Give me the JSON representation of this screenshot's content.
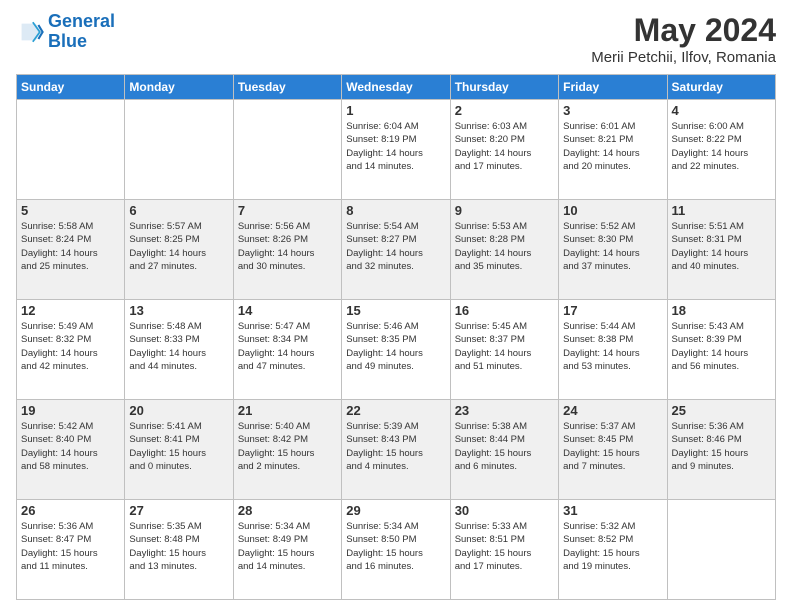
{
  "logo": {
    "line1": "General",
    "line2": "Blue"
  },
  "title": "May 2024",
  "subtitle": "Merii Petchii, Ilfov, Romania",
  "days_of_week": [
    "Sunday",
    "Monday",
    "Tuesday",
    "Wednesday",
    "Thursday",
    "Friday",
    "Saturday"
  ],
  "weeks": [
    [
      {
        "day": "",
        "info": ""
      },
      {
        "day": "",
        "info": ""
      },
      {
        "day": "",
        "info": ""
      },
      {
        "day": "1",
        "info": "Sunrise: 6:04 AM\nSunset: 8:19 PM\nDaylight: 14 hours\nand 14 minutes."
      },
      {
        "day": "2",
        "info": "Sunrise: 6:03 AM\nSunset: 8:20 PM\nDaylight: 14 hours\nand 17 minutes."
      },
      {
        "day": "3",
        "info": "Sunrise: 6:01 AM\nSunset: 8:21 PM\nDaylight: 14 hours\nand 20 minutes."
      },
      {
        "day": "4",
        "info": "Sunrise: 6:00 AM\nSunset: 8:22 PM\nDaylight: 14 hours\nand 22 minutes."
      }
    ],
    [
      {
        "day": "5",
        "info": "Sunrise: 5:58 AM\nSunset: 8:24 PM\nDaylight: 14 hours\nand 25 minutes."
      },
      {
        "day": "6",
        "info": "Sunrise: 5:57 AM\nSunset: 8:25 PM\nDaylight: 14 hours\nand 27 minutes."
      },
      {
        "day": "7",
        "info": "Sunrise: 5:56 AM\nSunset: 8:26 PM\nDaylight: 14 hours\nand 30 minutes."
      },
      {
        "day": "8",
        "info": "Sunrise: 5:54 AM\nSunset: 8:27 PM\nDaylight: 14 hours\nand 32 minutes."
      },
      {
        "day": "9",
        "info": "Sunrise: 5:53 AM\nSunset: 8:28 PM\nDaylight: 14 hours\nand 35 minutes."
      },
      {
        "day": "10",
        "info": "Sunrise: 5:52 AM\nSunset: 8:30 PM\nDaylight: 14 hours\nand 37 minutes."
      },
      {
        "day": "11",
        "info": "Sunrise: 5:51 AM\nSunset: 8:31 PM\nDaylight: 14 hours\nand 40 minutes."
      }
    ],
    [
      {
        "day": "12",
        "info": "Sunrise: 5:49 AM\nSunset: 8:32 PM\nDaylight: 14 hours\nand 42 minutes."
      },
      {
        "day": "13",
        "info": "Sunrise: 5:48 AM\nSunset: 8:33 PM\nDaylight: 14 hours\nand 44 minutes."
      },
      {
        "day": "14",
        "info": "Sunrise: 5:47 AM\nSunset: 8:34 PM\nDaylight: 14 hours\nand 47 minutes."
      },
      {
        "day": "15",
        "info": "Sunrise: 5:46 AM\nSunset: 8:35 PM\nDaylight: 14 hours\nand 49 minutes."
      },
      {
        "day": "16",
        "info": "Sunrise: 5:45 AM\nSunset: 8:37 PM\nDaylight: 14 hours\nand 51 minutes."
      },
      {
        "day": "17",
        "info": "Sunrise: 5:44 AM\nSunset: 8:38 PM\nDaylight: 14 hours\nand 53 minutes."
      },
      {
        "day": "18",
        "info": "Sunrise: 5:43 AM\nSunset: 8:39 PM\nDaylight: 14 hours\nand 56 minutes."
      }
    ],
    [
      {
        "day": "19",
        "info": "Sunrise: 5:42 AM\nSunset: 8:40 PM\nDaylight: 14 hours\nand 58 minutes."
      },
      {
        "day": "20",
        "info": "Sunrise: 5:41 AM\nSunset: 8:41 PM\nDaylight: 15 hours\nand 0 minutes."
      },
      {
        "day": "21",
        "info": "Sunrise: 5:40 AM\nSunset: 8:42 PM\nDaylight: 15 hours\nand 2 minutes."
      },
      {
        "day": "22",
        "info": "Sunrise: 5:39 AM\nSunset: 8:43 PM\nDaylight: 15 hours\nand 4 minutes."
      },
      {
        "day": "23",
        "info": "Sunrise: 5:38 AM\nSunset: 8:44 PM\nDaylight: 15 hours\nand 6 minutes."
      },
      {
        "day": "24",
        "info": "Sunrise: 5:37 AM\nSunset: 8:45 PM\nDaylight: 15 hours\nand 7 minutes."
      },
      {
        "day": "25",
        "info": "Sunrise: 5:36 AM\nSunset: 8:46 PM\nDaylight: 15 hours\nand 9 minutes."
      }
    ],
    [
      {
        "day": "26",
        "info": "Sunrise: 5:36 AM\nSunset: 8:47 PM\nDaylight: 15 hours\nand 11 minutes."
      },
      {
        "day": "27",
        "info": "Sunrise: 5:35 AM\nSunset: 8:48 PM\nDaylight: 15 hours\nand 13 minutes."
      },
      {
        "day": "28",
        "info": "Sunrise: 5:34 AM\nSunset: 8:49 PM\nDaylight: 15 hours\nand 14 minutes."
      },
      {
        "day": "29",
        "info": "Sunrise: 5:34 AM\nSunset: 8:50 PM\nDaylight: 15 hours\nand 16 minutes."
      },
      {
        "day": "30",
        "info": "Sunrise: 5:33 AM\nSunset: 8:51 PM\nDaylight: 15 hours\nand 17 minutes."
      },
      {
        "day": "31",
        "info": "Sunrise: 5:32 AM\nSunset: 8:52 PM\nDaylight: 15 hours\nand 19 minutes."
      },
      {
        "day": "",
        "info": ""
      }
    ]
  ]
}
